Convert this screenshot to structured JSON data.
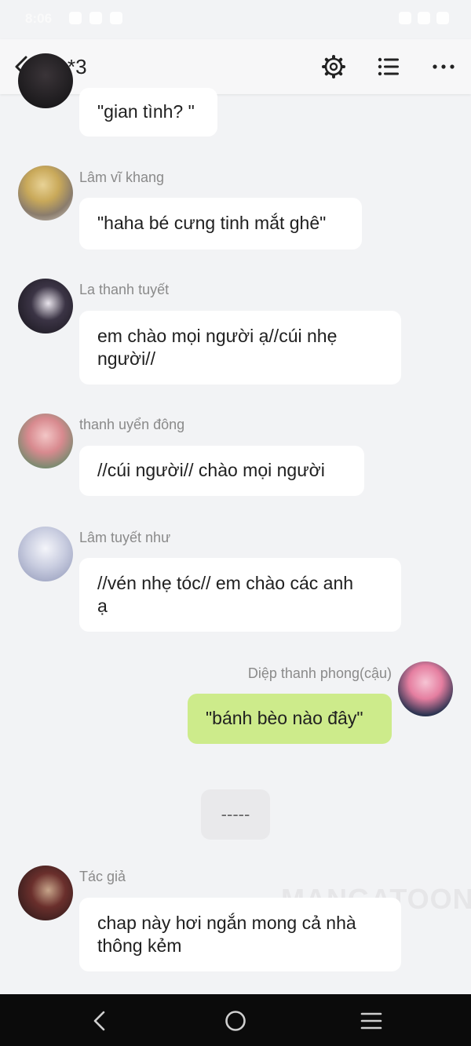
{
  "status_bar": {
    "time": "8:06"
  },
  "header": {
    "title": "*3"
  },
  "messages": [
    {
      "name": "",
      "text_lines": [
        "\"gian tình? \""
      ]
    },
    {
      "name": "Lâm vĩ khang",
      "text_lines": [
        "\"haha bé cưng tinh mắt ghê\""
      ]
    },
    {
      "name": "La thanh tuyết",
      "text_lines": [
        "em chào mọi người ạ//cúi nhẹ",
        "người//"
      ]
    },
    {
      "name": "thanh uyển đông",
      "text_lines": [
        "//cúi người// chào mọi người"
      ]
    },
    {
      "name": "Lâm  tuyết như",
      "text_lines": [
        "//vén nhẹ tóc// em chào các anh",
        "ạ"
      ]
    },
    {
      "name": "Diệp thanh phong(cậu)",
      "text_lines": [
        "\"bánh bèo nào đây\""
      ]
    },
    {
      "name": "Tác giả",
      "text_lines": [
        "chap này hơi ngắn mong cả nhà",
        "thông kẻm"
      ]
    }
  ],
  "divider": {
    "text": "-----"
  },
  "watermark": {
    "text": "MANGATOON"
  },
  "colors": {
    "background": "#f2f3f5",
    "bubble": "#ffffff",
    "own_bubble": "#cdeb8b",
    "name": "#8a8a8a",
    "nav": "#0b0b0b"
  },
  "icons": {
    "back": "chevron-left-icon",
    "settings": "gear-icon",
    "list": "list-icon",
    "more": "more-dots-icon"
  }
}
